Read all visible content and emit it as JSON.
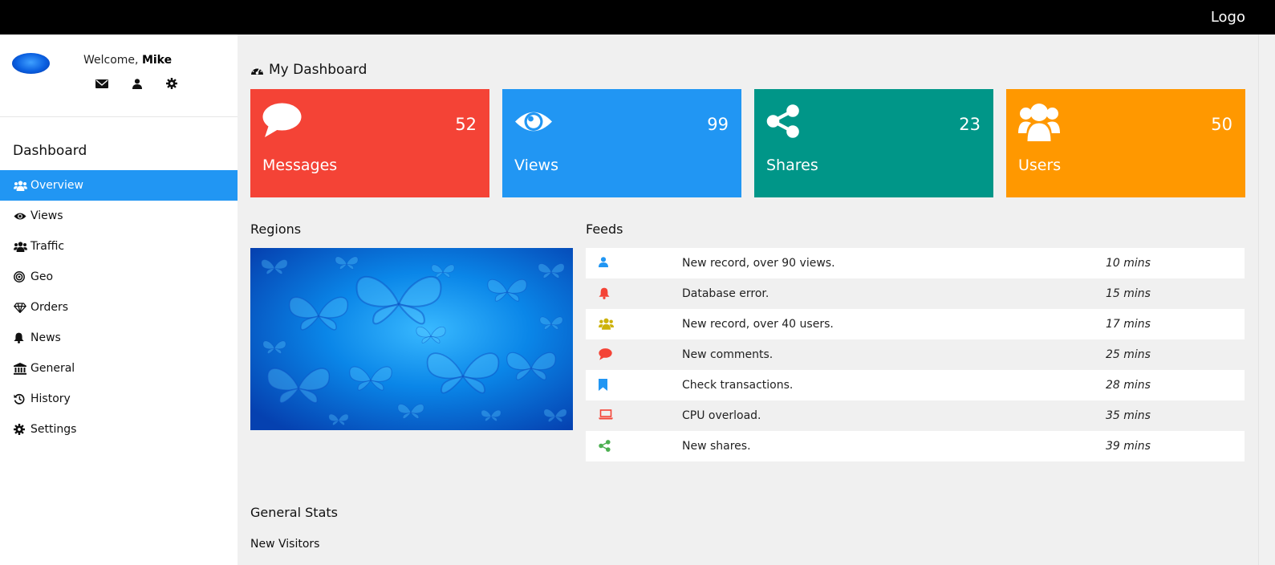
{
  "topbar": {
    "logo": "Logo"
  },
  "sidebar": {
    "welcome_prefix": "Welcome, ",
    "user_name": "Mike",
    "user_icons": [
      "envelope-icon",
      "user-icon",
      "gear-icon"
    ],
    "nav_title": "Dashboard",
    "items": [
      {
        "label": "Overview",
        "icon": "users-icon",
        "active": true
      },
      {
        "label": "Views",
        "icon": "eye-icon"
      },
      {
        "label": "Traffic",
        "icon": "users-icon"
      },
      {
        "label": "Geo",
        "icon": "bullseye-icon"
      },
      {
        "label": "Orders",
        "icon": "diamond-icon"
      },
      {
        "label": "News",
        "icon": "bell-icon"
      },
      {
        "label": "General",
        "icon": "bank-icon"
      },
      {
        "label": "History",
        "icon": "history-icon"
      },
      {
        "label": "Settings",
        "icon": "gear-icon"
      }
    ]
  },
  "main": {
    "page_title": "My Dashboard",
    "cards": [
      {
        "label": "Messages",
        "count": "52",
        "color": "#f44336",
        "icon": "comment-icon"
      },
      {
        "label": "Views",
        "count": "99",
        "color": "#2196f3",
        "icon": "eye-icon"
      },
      {
        "label": "Shares",
        "count": "23",
        "color": "#009688",
        "icon": "share-icon"
      },
      {
        "label": "Users",
        "count": "50",
        "color": "#ff9800",
        "icon": "users-icon"
      }
    ],
    "regions_title": "Regions",
    "feeds_title": "Feeds",
    "feeds": [
      {
        "text": "New record, over 90 views.",
        "time": "10 mins",
        "icon": "user-icon",
        "color": "#2196f3"
      },
      {
        "text": "Database error.",
        "time": "15 mins",
        "icon": "bell-icon",
        "color": "#f44336"
      },
      {
        "text": "New record, over 40 users.",
        "time": "17 mins",
        "icon": "users-icon",
        "color": "#cdb20a"
      },
      {
        "text": "New comments.",
        "time": "25 mins",
        "icon": "comment-icon",
        "color": "#f44336"
      },
      {
        "text": "Check transactions.",
        "time": "28 mins",
        "icon": "bookmark-icon",
        "color": "#2196f3"
      },
      {
        "text": "CPU overload.",
        "time": "35 mins",
        "icon": "laptop-icon",
        "color": "#f44336"
      },
      {
        "text": "New shares.",
        "time": "39 mins",
        "icon": "share-icon",
        "color": "#4caf50"
      }
    ],
    "general_stats_title": "General Stats",
    "new_visitors_label": "New Visitors"
  }
}
